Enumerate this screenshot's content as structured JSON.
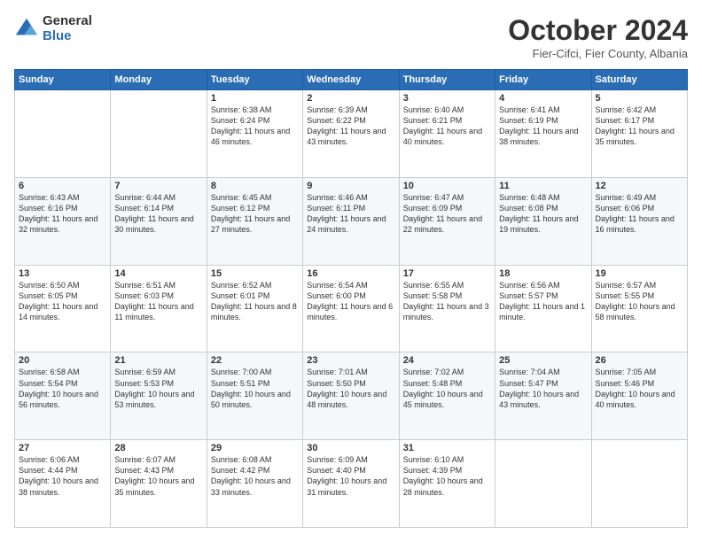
{
  "logo": {
    "general": "General",
    "blue": "Blue"
  },
  "header": {
    "month": "October 2024",
    "location": "Fier-Cifci, Fier County, Albania"
  },
  "columns": [
    "Sunday",
    "Monday",
    "Tuesday",
    "Wednesday",
    "Thursday",
    "Friday",
    "Saturday"
  ],
  "weeks": [
    [
      {
        "day": "",
        "info": ""
      },
      {
        "day": "",
        "info": ""
      },
      {
        "day": "1",
        "info": "Sunrise: 6:38 AM\nSunset: 6:24 PM\nDaylight: 11 hours and 46 minutes."
      },
      {
        "day": "2",
        "info": "Sunrise: 6:39 AM\nSunset: 6:22 PM\nDaylight: 11 hours and 43 minutes."
      },
      {
        "day": "3",
        "info": "Sunrise: 6:40 AM\nSunset: 6:21 PM\nDaylight: 11 hours and 40 minutes."
      },
      {
        "day": "4",
        "info": "Sunrise: 6:41 AM\nSunset: 6:19 PM\nDaylight: 11 hours and 38 minutes."
      },
      {
        "day": "5",
        "info": "Sunrise: 6:42 AM\nSunset: 6:17 PM\nDaylight: 11 hours and 35 minutes."
      }
    ],
    [
      {
        "day": "6",
        "info": "Sunrise: 6:43 AM\nSunset: 6:16 PM\nDaylight: 11 hours and 32 minutes."
      },
      {
        "day": "7",
        "info": "Sunrise: 6:44 AM\nSunset: 6:14 PM\nDaylight: 11 hours and 30 minutes."
      },
      {
        "day": "8",
        "info": "Sunrise: 6:45 AM\nSunset: 6:12 PM\nDaylight: 11 hours and 27 minutes."
      },
      {
        "day": "9",
        "info": "Sunrise: 6:46 AM\nSunset: 6:11 PM\nDaylight: 11 hours and 24 minutes."
      },
      {
        "day": "10",
        "info": "Sunrise: 6:47 AM\nSunset: 6:09 PM\nDaylight: 11 hours and 22 minutes."
      },
      {
        "day": "11",
        "info": "Sunrise: 6:48 AM\nSunset: 6:08 PM\nDaylight: 11 hours and 19 minutes."
      },
      {
        "day": "12",
        "info": "Sunrise: 6:49 AM\nSunset: 6:06 PM\nDaylight: 11 hours and 16 minutes."
      }
    ],
    [
      {
        "day": "13",
        "info": "Sunrise: 6:50 AM\nSunset: 6:05 PM\nDaylight: 11 hours and 14 minutes."
      },
      {
        "day": "14",
        "info": "Sunrise: 6:51 AM\nSunset: 6:03 PM\nDaylight: 11 hours and 11 minutes."
      },
      {
        "day": "15",
        "info": "Sunrise: 6:52 AM\nSunset: 6:01 PM\nDaylight: 11 hours and 8 minutes."
      },
      {
        "day": "16",
        "info": "Sunrise: 6:54 AM\nSunset: 6:00 PM\nDaylight: 11 hours and 6 minutes."
      },
      {
        "day": "17",
        "info": "Sunrise: 6:55 AM\nSunset: 5:58 PM\nDaylight: 11 hours and 3 minutes."
      },
      {
        "day": "18",
        "info": "Sunrise: 6:56 AM\nSunset: 5:57 PM\nDaylight: 11 hours and 1 minute."
      },
      {
        "day": "19",
        "info": "Sunrise: 6:57 AM\nSunset: 5:55 PM\nDaylight: 10 hours and 58 minutes."
      }
    ],
    [
      {
        "day": "20",
        "info": "Sunrise: 6:58 AM\nSunset: 5:54 PM\nDaylight: 10 hours and 56 minutes."
      },
      {
        "day": "21",
        "info": "Sunrise: 6:59 AM\nSunset: 5:53 PM\nDaylight: 10 hours and 53 minutes."
      },
      {
        "day": "22",
        "info": "Sunrise: 7:00 AM\nSunset: 5:51 PM\nDaylight: 10 hours and 50 minutes."
      },
      {
        "day": "23",
        "info": "Sunrise: 7:01 AM\nSunset: 5:50 PM\nDaylight: 10 hours and 48 minutes."
      },
      {
        "day": "24",
        "info": "Sunrise: 7:02 AM\nSunset: 5:48 PM\nDaylight: 10 hours and 45 minutes."
      },
      {
        "day": "25",
        "info": "Sunrise: 7:04 AM\nSunset: 5:47 PM\nDaylight: 10 hours and 43 minutes."
      },
      {
        "day": "26",
        "info": "Sunrise: 7:05 AM\nSunset: 5:46 PM\nDaylight: 10 hours and 40 minutes."
      }
    ],
    [
      {
        "day": "27",
        "info": "Sunrise: 6:06 AM\nSunset: 4:44 PM\nDaylight: 10 hours and 38 minutes."
      },
      {
        "day": "28",
        "info": "Sunrise: 6:07 AM\nSunset: 4:43 PM\nDaylight: 10 hours and 35 minutes."
      },
      {
        "day": "29",
        "info": "Sunrise: 6:08 AM\nSunset: 4:42 PM\nDaylight: 10 hours and 33 minutes."
      },
      {
        "day": "30",
        "info": "Sunrise: 6:09 AM\nSunset: 4:40 PM\nDaylight: 10 hours and 31 minutes."
      },
      {
        "day": "31",
        "info": "Sunrise: 6:10 AM\nSunset: 4:39 PM\nDaylight: 10 hours and 28 minutes."
      },
      {
        "day": "",
        "info": ""
      },
      {
        "day": "",
        "info": ""
      }
    ]
  ]
}
